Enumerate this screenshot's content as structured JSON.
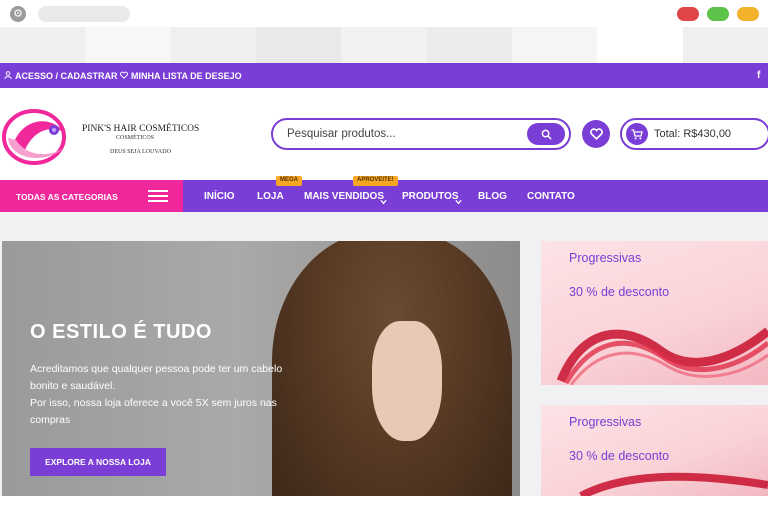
{
  "topbar": {
    "account": "ACESSO / CADASTRAR",
    "wishlist": "MINHA LISTA DE DESEJO",
    "facebook": "f"
  },
  "logo": {
    "line1": "PINK'S HAIR COSMÉTICOS",
    "line2": "COSMÉTICOS",
    "line3": "DEUS SEJA LOUVADO"
  },
  "search": {
    "placeholder": "Pesquisar produtos..."
  },
  "cart": {
    "total": "Total: R$430,00"
  },
  "nav": {
    "categories": "TODAS AS CATEGORIAS",
    "items": [
      "INÍCIO",
      "LOJA",
      "MAIS VENDIDOS",
      "PRODUTOS",
      "BLOG",
      "CONTATO"
    ],
    "badges": {
      "loja": "MEGA",
      "mais_vendidos": "APROVEITE!"
    }
  },
  "hero": {
    "title": "O ESTILO É TUDO",
    "line1": "Acreditamos que qualquer pessoa pode ter um cabelo",
    "line2": "bonito e saudável.",
    "line3": "Por isso, nossa loja oferece a você 5X sem juros nas",
    "line4": "compras",
    "button": "EXPLORE A NOSSA LOJA"
  },
  "promos": [
    {
      "title": "Progressivas",
      "discount": "30 % de desconto"
    },
    {
      "title": "Progressivas",
      "discount": "30 % de desconto"
    }
  ],
  "colors": {
    "brand_purple": "#7a3ed6",
    "brand_pink": "#f0289b"
  }
}
